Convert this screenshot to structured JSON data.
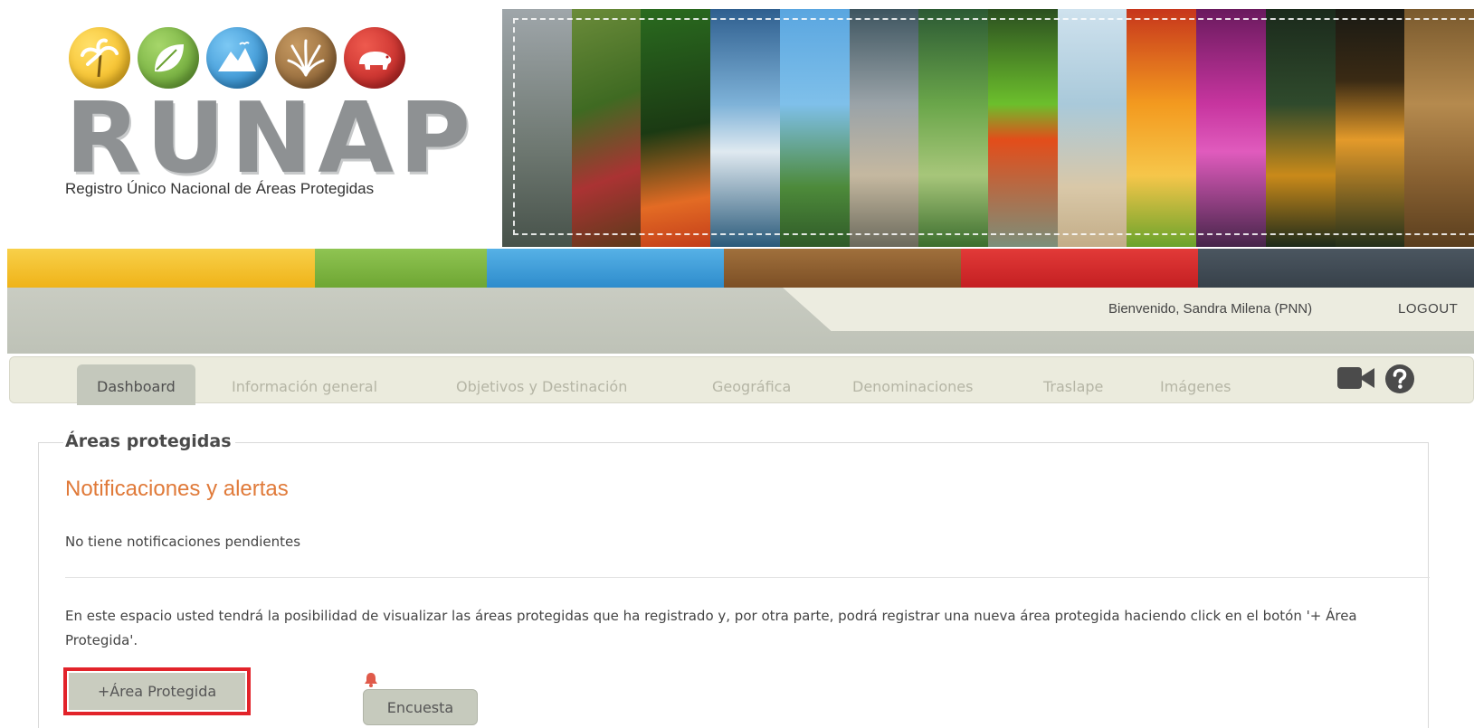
{
  "brand": {
    "name": "RUNAP",
    "subtitle": "Registro Único Nacional de Áreas Protegidas",
    "icons": [
      "palm-tree-icon",
      "leaf-icon",
      "mountain-icon",
      "grass-icon",
      "bear-icon"
    ]
  },
  "colors": {
    "bar": [
      "#f4c12b",
      "#79b340",
      "#3f9fd8",
      "#8b5a2b",
      "#d8282c",
      "#3d4750"
    ],
    "accent_orange": "#e07a39",
    "highlight_red": "#e2232a",
    "nav_bg": "#ebebdd"
  },
  "header": {
    "welcome": "Bienvenido, Sandra Milena (PNN)",
    "logout": "LOGOUT"
  },
  "nav": {
    "tabs": [
      {
        "label": "Dashboard",
        "active": true
      },
      {
        "label": "Información general",
        "active": false
      },
      {
        "label": "Objetivos y Destinación",
        "active": false
      },
      {
        "label": "Geográfica",
        "active": false
      },
      {
        "label": "Denominaciones",
        "active": false
      },
      {
        "label": "Traslape",
        "active": false
      },
      {
        "label": "Imágenes",
        "active": false
      }
    ],
    "icons": [
      "video-camera-icon",
      "help-icon"
    ]
  },
  "main": {
    "section_title": "Áreas protegidas",
    "notifications_title": "Notificaciones y alertas",
    "notifications_empty": "No tiene notificaciones pendientes",
    "description": "En este espacio usted tendrá la posibilidad de visualizar las áreas protegidas que ha registrado y, por otra parte, podrá registrar una nueva área protegida haciendo click en el botón '+ Área Protegida'.",
    "add_button": "+Área Protegida",
    "survey_button": "Encuesta"
  }
}
